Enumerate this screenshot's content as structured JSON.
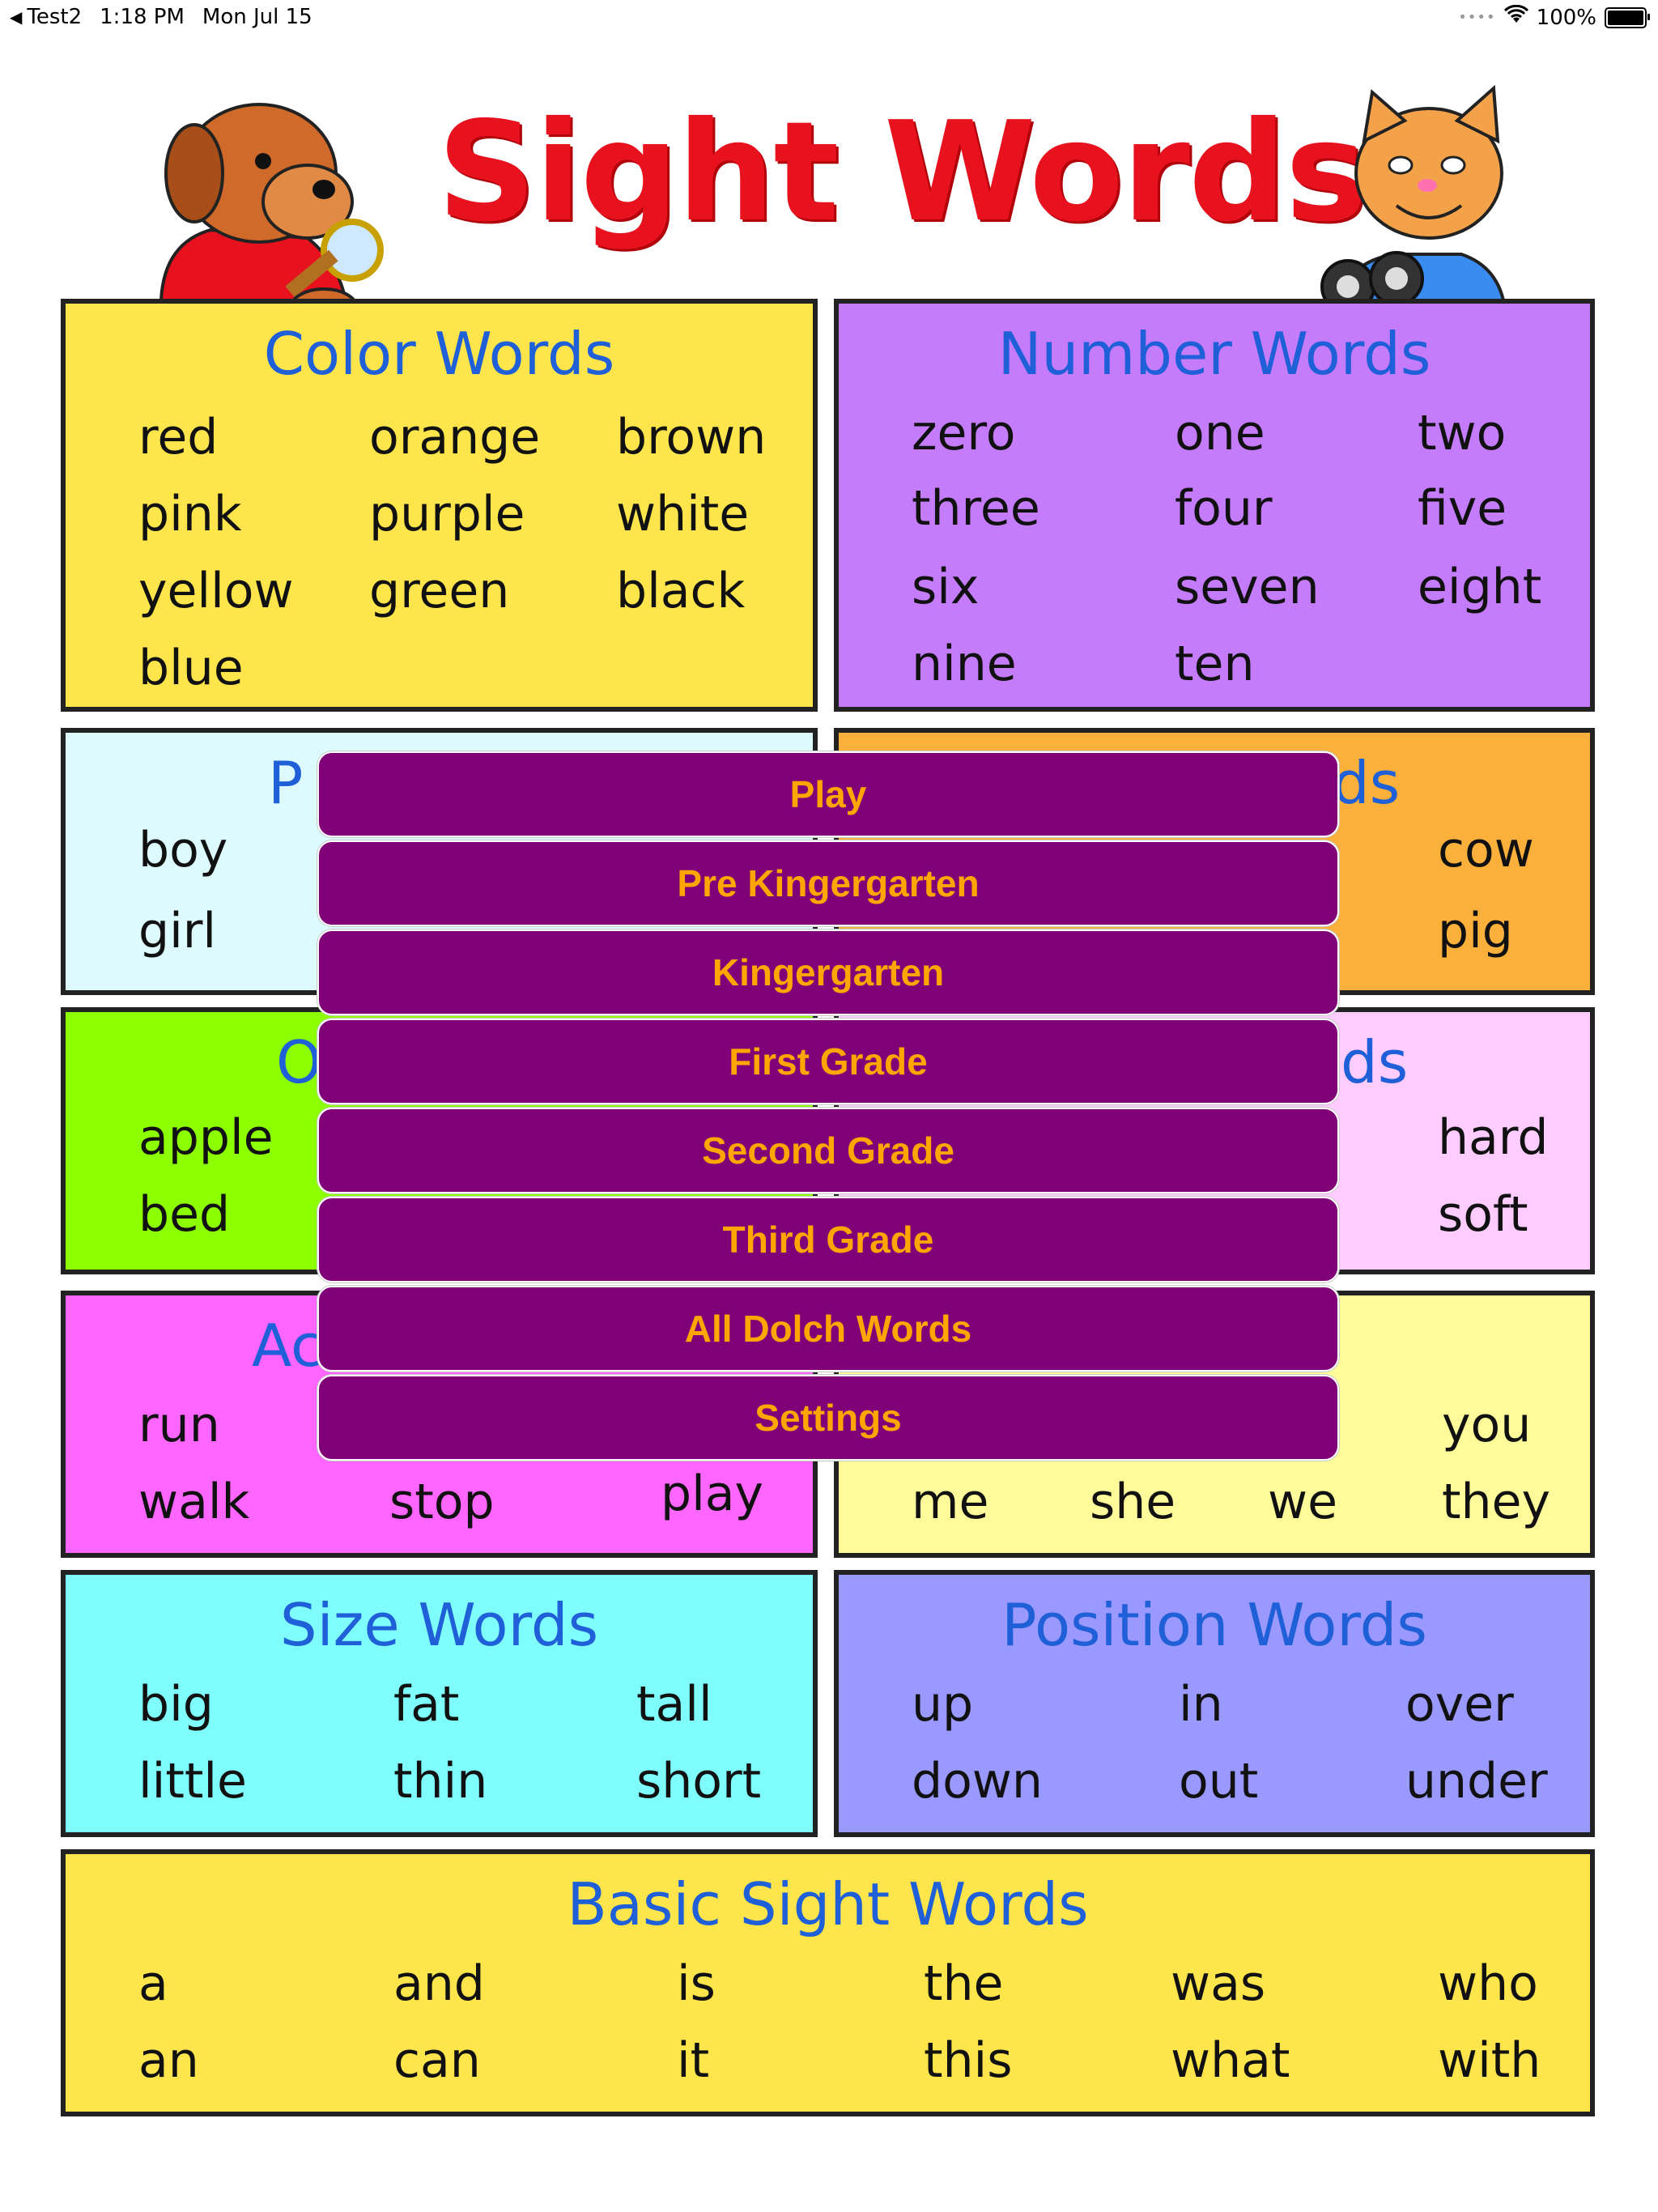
{
  "status_bar": {
    "back_app": "Test2",
    "time": "1:18 PM",
    "date": "Mon Jul 15",
    "battery": "100%"
  },
  "poster": {
    "title": "Sight Words",
    "colors": {
      "title": "#e8121f",
      "heading": "#1f5fd8",
      "color_box": "#fde54b",
      "number_box": "#c47cfa",
      "people_box": "#ddfbff",
      "animal_box": "#fbb03b",
      "object_box": "#8cff00",
      "opposite_box": "#ffccff",
      "action_box": "#ff66ff",
      "pronoun_box": "#fffb9a",
      "size_box": "#7ffcfc",
      "position_box": "#9999ff",
      "basic_box": "#fde54b"
    },
    "sections": {
      "color": {
        "heading": "Color Words",
        "words": [
          "red",
          "orange",
          "brown",
          "pink",
          "purple",
          "white",
          "yellow",
          "green",
          "black",
          "blue"
        ]
      },
      "number": {
        "heading": "Number Words",
        "words": [
          "zero",
          "one",
          "two",
          "three",
          "four",
          "five",
          "six",
          "seven",
          "eight",
          "nine",
          "ten"
        ]
      },
      "people": {
        "heading_partial": "P",
        "words": [
          "boy",
          "girl"
        ]
      },
      "animal": {
        "heading_partial": "ds",
        "words": [
          "cow",
          "pig"
        ]
      },
      "object": {
        "heading_partial": "O",
        "words": [
          "apple",
          "bed"
        ]
      },
      "opposite": {
        "heading_partial": "ds",
        "words": [
          "hard",
          "soft"
        ]
      },
      "action": {
        "heading_partial": "Ac",
        "words": [
          "run",
          "walk",
          "stop",
          "play"
        ]
      },
      "pronoun": {
        "words": [
          "you",
          "me",
          "she",
          "we",
          "they"
        ]
      },
      "size": {
        "heading": "Size Words",
        "words": [
          "big",
          "fat",
          "tall",
          "little",
          "thin",
          "short"
        ]
      },
      "position": {
        "heading": "Position Words",
        "words": [
          "up",
          "in",
          "over",
          "down",
          "out",
          "under"
        ]
      },
      "basic": {
        "heading": "Basic Sight Words",
        "words": [
          "a",
          "and",
          "is",
          "the",
          "was",
          "who",
          "an",
          "can",
          "it",
          "this",
          "what",
          "with"
        ]
      }
    }
  },
  "menu": {
    "items": [
      {
        "label": "Play"
      },
      {
        "label": "Pre Kingergarten"
      },
      {
        "label": "Kingergarten"
      },
      {
        "label": "First Grade"
      },
      {
        "label": "Second Grade"
      },
      {
        "label": "Third Grade"
      },
      {
        "label": "All Dolch Words"
      },
      {
        "label": "Settings"
      }
    ],
    "colors": {
      "background": "#800078",
      "text": "#ffa500"
    }
  }
}
